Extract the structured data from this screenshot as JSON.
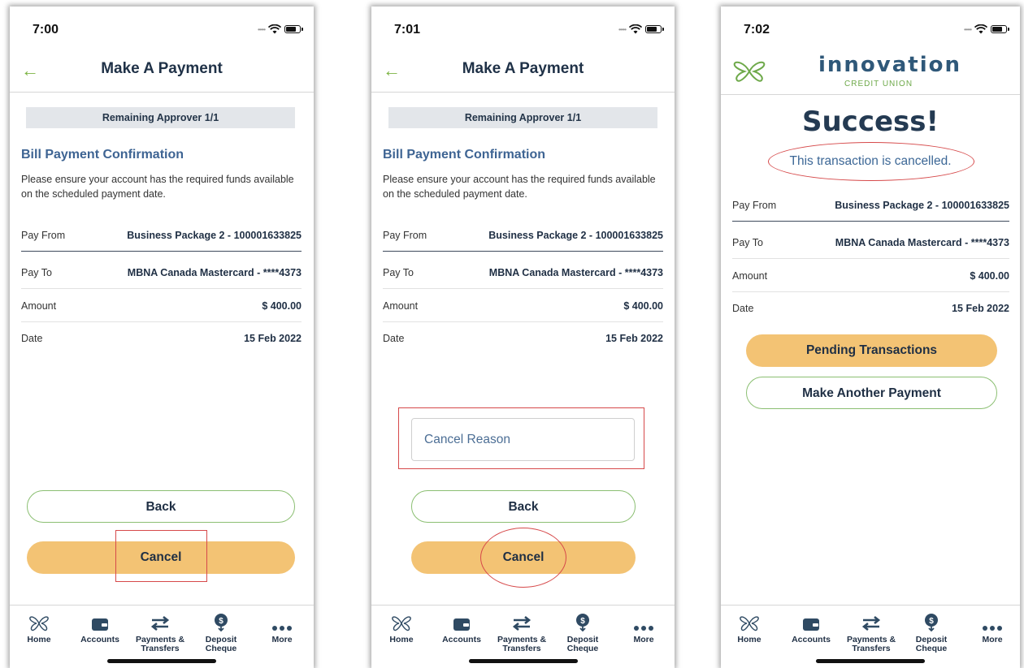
{
  "screens": [
    {
      "time": "7:00",
      "header_title": "Make A Payment",
      "approver": "Remaining Approver 1/1",
      "confirmation_title": "Bill Payment Confirmation",
      "confirmation_text": "Please ensure your account has the required funds available on the scheduled payment date.",
      "details": [
        {
          "label": "Pay From",
          "value": "Business Package 2 - 100001633825"
        },
        {
          "label": "Pay To",
          "value": "MBNA Canada Mastercard - ****4373"
        },
        {
          "label": "Amount",
          "value": "$ 400.00"
        },
        {
          "label": "Date",
          "value": "15 Feb 2022"
        }
      ],
      "back_label": "Back",
      "cancel_label": "Cancel"
    },
    {
      "time": "7:01",
      "header_title": "Make A Payment",
      "approver": "Remaining Approver 1/1",
      "confirmation_title": "Bill Payment Confirmation",
      "confirmation_text": "Please ensure your account has the required funds available on the scheduled payment date.",
      "details": [
        {
          "label": "Pay From",
          "value": "Business Package 2 - 100001633825"
        },
        {
          "label": "Pay To",
          "value": "MBNA Canada Mastercard - ****4373"
        },
        {
          "label": "Amount",
          "value": "$ 400.00"
        },
        {
          "label": "Date",
          "value": "15 Feb 2022"
        }
      ],
      "cancel_reason_placeholder": "Cancel Reason",
      "back_label": "Back",
      "cancel_label": "Cancel"
    },
    {
      "time": "7:02",
      "logo_text": "innovation",
      "logo_subtitle": "CREDIT UNION",
      "success_title": "Success!",
      "success_message": "This transaction is cancelled.",
      "details": [
        {
          "label": "Pay From",
          "value": "Business Package 2 - 100001633825"
        },
        {
          "label": "Pay To",
          "value": "MBNA Canada Mastercard - ****4373"
        },
        {
          "label": "Amount",
          "value": "$ 400.00"
        },
        {
          "label": "Date",
          "value": "15 Feb 2022"
        }
      ],
      "pending_label": "Pending Transactions",
      "another_label": "Make Another Payment"
    }
  ],
  "tabbar": {
    "home": "Home",
    "accounts": "Accounts",
    "payments_1": "Payments &",
    "payments_2": "Transfers",
    "deposit_1": "Deposit",
    "deposit_2": "Cheque",
    "more": "More"
  },
  "colors": {
    "accent_green": "#7cb342",
    "button_gold": "#f3c374",
    "navy": "#1f3147",
    "link_blue": "#3e6493",
    "annotation_red": "#d6494a"
  }
}
